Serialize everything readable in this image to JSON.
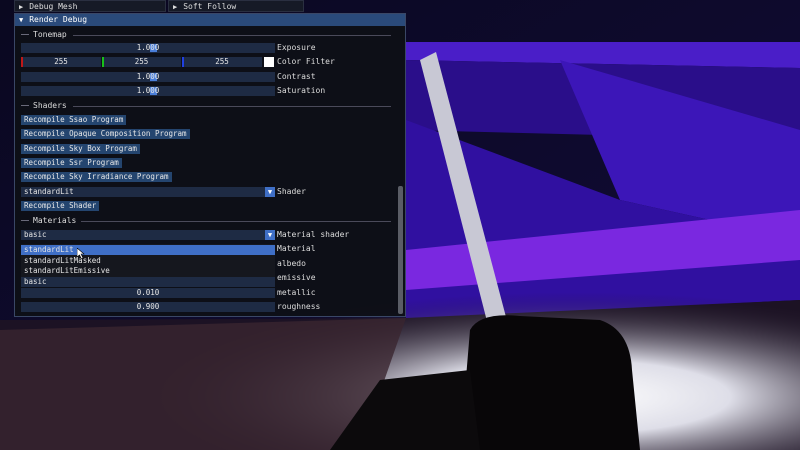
{
  "topbar": {
    "debug_mesh": "Debug Mesh",
    "soft_follow": "Soft Follow"
  },
  "window": {
    "title": "Render Debug",
    "title_color": "#2a4a7a",
    "accent": "#3f6fc6",
    "tonemap": {
      "header": "Tonemap",
      "exposure": {
        "value": "1.000",
        "label": "Exposure"
      },
      "color_filter": {
        "r": "255",
        "g": "255",
        "b": "255",
        "label": "Color Filter",
        "swatch": "#ffffff"
      },
      "contrast": {
        "value": "1.000",
        "label": "Contrast"
      },
      "saturation": {
        "value": "1.000",
        "label": "Saturation"
      }
    },
    "shaders": {
      "header": "Shaders",
      "buttons": [
        "Recompile Ssao Program",
        "Recompile Opaque Composition Program",
        "Recompile Sky Box Program",
        "Recompile Ssr Program",
        "Recompile Sky Irradiance Program"
      ],
      "shader_select": "standardLit",
      "shader_label": "Shader",
      "recompile_shader": "Recompile Shader"
    },
    "materials": {
      "header": "Materials",
      "material_shader_select": "basic",
      "material_shader_label": "Material shader",
      "dropdown_options": [
        "standardLit",
        "standardLitMasked",
        "standardLitEmissive",
        "basic"
      ],
      "rows": [
        {
          "label": "Material"
        },
        {
          "label": "albedo"
        },
        {
          "label": "emissive"
        },
        {
          "value": "0.010",
          "label": "metallic"
        },
        {
          "value": "0.900",
          "label": "roughness"
        }
      ]
    }
  }
}
